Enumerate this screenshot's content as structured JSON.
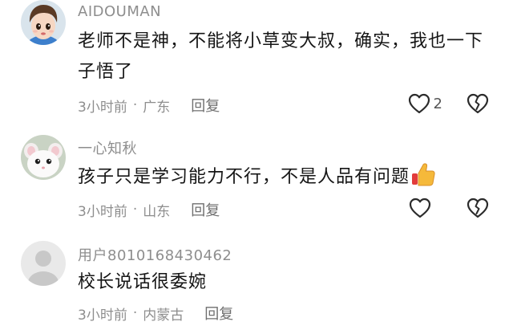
{
  "comments": [
    {
      "username": "AIDOUMAN",
      "text_line1": "老师不是神，不能将小草变大叔，确实，我也一下",
      "text_line2": "子悟了",
      "time": "3小时前",
      "separator": "·",
      "location": "广东",
      "reply_label": "回复",
      "like_count": "2",
      "avatar_icon": "cartoon-boy-avatar"
    },
    {
      "username": "一心知秋",
      "text": "孩子只是学习能力不行，不是人品有问题",
      "text_emoji": "thumbs-up-emoji",
      "time": "3小时前",
      "separator": "·",
      "location": "山东",
      "reply_label": "回复",
      "like_count": "",
      "avatar_icon": "white-mouse-avatar"
    },
    {
      "username": "用户8010168430462",
      "text": "校长说话很委婉",
      "time": "3小时前",
      "separator": "·",
      "location": "内蒙古",
      "reply_label": "回复",
      "avatar_icon": "default-user-avatar"
    }
  ],
  "colors": {
    "meta_text": "#8e8e8e",
    "body_text": "#151515",
    "icon_stroke": "#2b2b2b"
  }
}
